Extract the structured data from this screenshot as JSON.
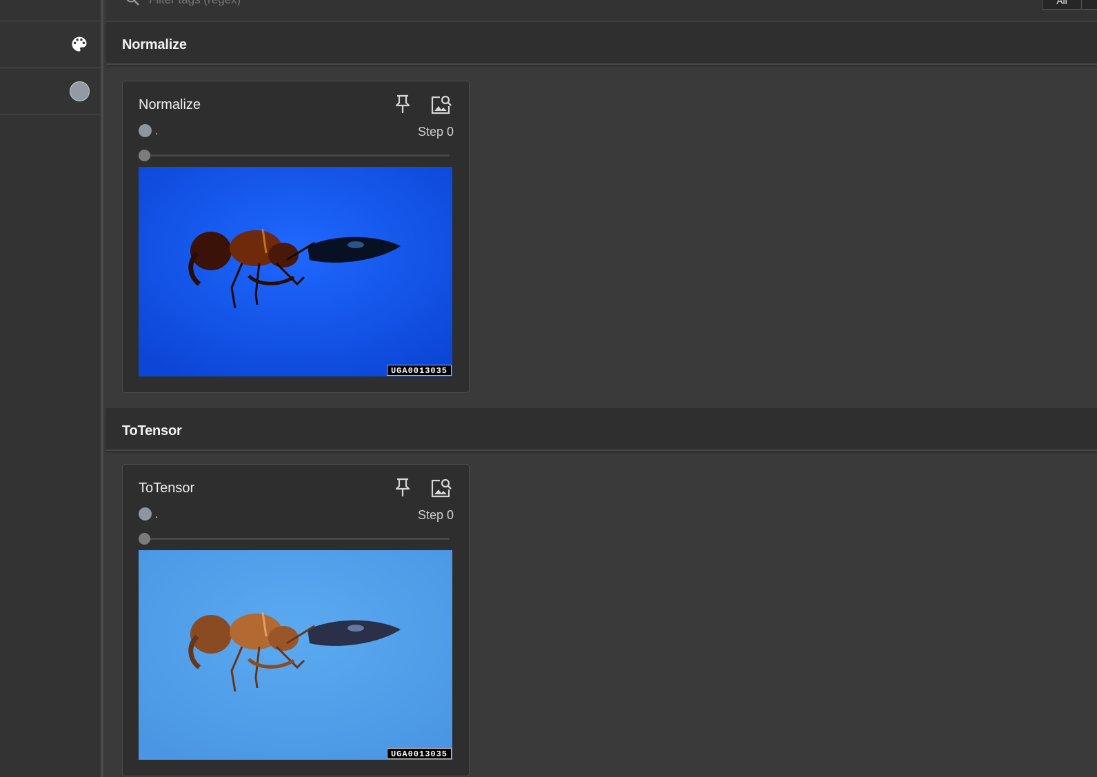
{
  "search": {
    "placeholder": "Filter tags (regex)"
  },
  "toolbar": {
    "button_1_label": "All",
    "button_2_label": ""
  },
  "sidebar": {
    "items": [
      {
        "icon": "palette-icon"
      },
      {
        "icon": "color-swatch",
        "color": "#939aa3"
      }
    ]
  },
  "sections": [
    {
      "title": "Normalize",
      "card": {
        "title": "Normalize",
        "run_label": ".",
        "run_color": "#8f969e",
        "step": "Step 0",
        "image": {
          "tag": "UGA0013035",
          "background": "#1556e8"
        }
      }
    },
    {
      "title": "ToTensor",
      "card": {
        "title": "ToTensor",
        "run_label": ".",
        "run_color": "#8f969e",
        "step": "Step 0",
        "image": {
          "tag": "UGA0013035",
          "background": "#4e9fe8"
        }
      }
    }
  ]
}
